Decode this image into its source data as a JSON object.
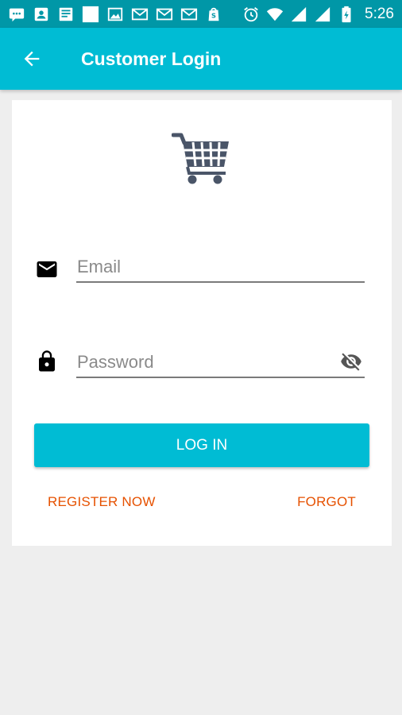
{
  "status_bar": {
    "time": "5:26",
    "left_icons": [
      "chat-icon",
      "contact-card-icon",
      "news-icon",
      "blank-square-icon",
      "image-icon",
      "gmail-icon",
      "gmail-icon",
      "gmail-icon",
      "shopify-icon"
    ],
    "right_icons": [
      "alarm-icon",
      "wifi-icon",
      "signal-icon",
      "signal-icon",
      "battery-icon"
    ]
  },
  "app_bar": {
    "title": "Customer Login",
    "back_icon": "arrow-back-icon",
    "color": "#00bcd4"
  },
  "login_form": {
    "logo_icon": "shopping-cart-icon",
    "email": {
      "placeholder": "Email",
      "value": "",
      "icon": "mail-icon"
    },
    "password": {
      "placeholder": "Password",
      "value": "",
      "icon": "lock-icon",
      "toggle_icon": "eye-off-icon"
    },
    "login_label": "LOG IN",
    "register_label": "REGISTER NOW",
    "forgot_label": "FORGOT",
    "accent_color": "#e65100"
  }
}
